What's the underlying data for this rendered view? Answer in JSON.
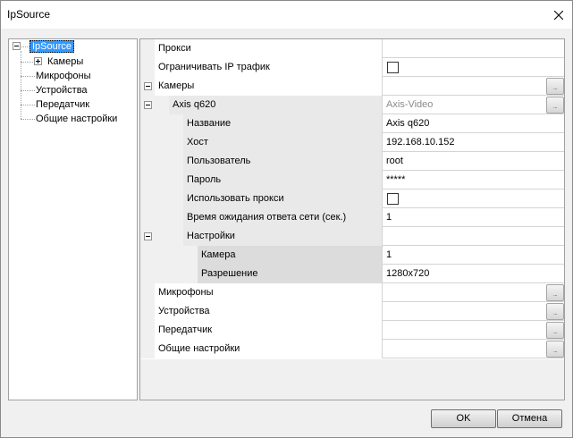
{
  "window": {
    "title": "IpSource"
  },
  "tree": {
    "root": "IpSource",
    "items": [
      {
        "label": "Камеры",
        "expandable": true
      },
      {
        "label": "Микрофоны",
        "expandable": false
      },
      {
        "label": "Устройства",
        "expandable": false
      },
      {
        "label": "Передатчик",
        "expandable": false
      },
      {
        "label": "Общие настройки",
        "expandable": false
      }
    ]
  },
  "grid": {
    "rows": [
      {
        "name": "Прокси",
        "value": ""
      },
      {
        "name": "Ограничивать IP трафик",
        "value": ""
      },
      {
        "name": "Камеры",
        "value": ""
      },
      {
        "name": "Axis q620",
        "value": "Axis-Video"
      },
      {
        "name": "Название",
        "value": "Axis q620"
      },
      {
        "name": "Хост",
        "value": "192.168.10.152"
      },
      {
        "name": "Пользователь",
        "value": "root"
      },
      {
        "name": "Пароль",
        "value": "*****"
      },
      {
        "name": "Использовать прокси",
        "value": ""
      },
      {
        "name": "Время ожидания ответа сети (сек.)",
        "value": "1"
      },
      {
        "name": "Настройки",
        "value": ""
      },
      {
        "name": "Камера",
        "value": "1"
      },
      {
        "name": "Разрешение",
        "value": "1280x720"
      },
      {
        "name": "Микрофоны",
        "value": ""
      },
      {
        "name": "Устройства",
        "value": ""
      },
      {
        "name": "Передатчик",
        "value": ""
      },
      {
        "name": "Общие настройки",
        "value": ""
      }
    ]
  },
  "buttons": {
    "ok": "OK",
    "cancel": "Отмена"
  },
  "icons": {
    "ellipsis": "..."
  }
}
